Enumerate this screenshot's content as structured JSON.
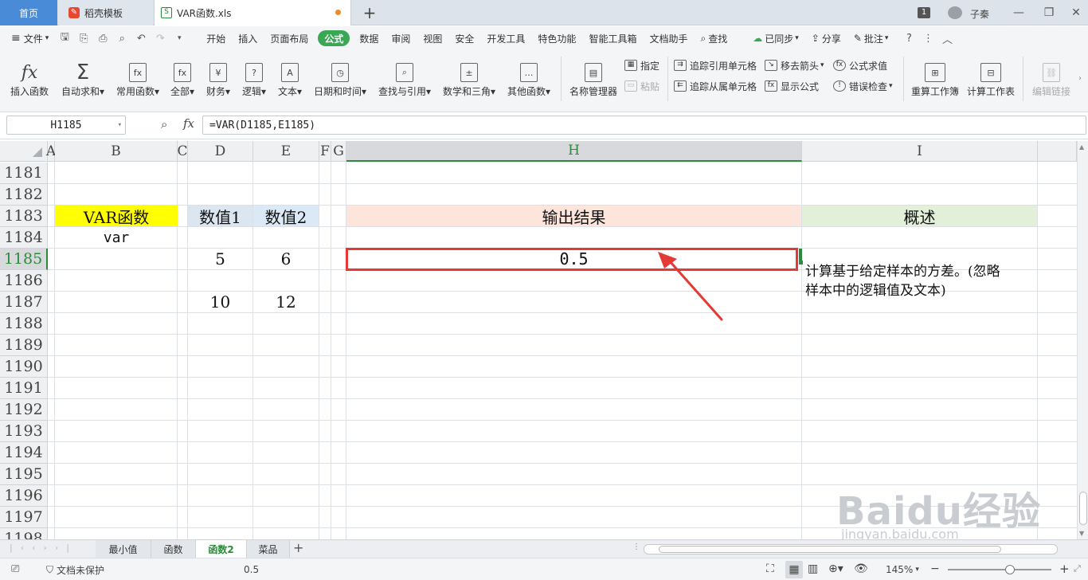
{
  "window": {
    "tabs": [
      {
        "label": "首页"
      },
      {
        "label": "稻壳模板"
      },
      {
        "label": "VAR函数.xls"
      }
    ],
    "page_badge": "1",
    "user_name": "子秦"
  },
  "menubar": {
    "file_label": "文件",
    "items": [
      "开始",
      "插入",
      "页面布局",
      "公式",
      "数据",
      "审阅",
      "视图",
      "安全",
      "开发工具",
      "特色功能",
      "智能工具箱",
      "文档助手"
    ],
    "active_item": "公式",
    "search_label": "查找",
    "sync_label": "已同步",
    "share_label": "分享",
    "comment_label": "批注"
  },
  "ribbon": {
    "insert_fn": "插入函数",
    "autosum": "自动求和",
    "common_fn": "常用函数",
    "all": "全部",
    "finance": "财务",
    "logic": "逻辑",
    "text": "文本",
    "datetime": "日期和时间",
    "lookup": "查找与引用",
    "math": "数学和三角",
    "other_fn": "其他函数",
    "name_mgr": "名称管理器",
    "specify": "指定",
    "paste": "粘贴",
    "trace_prec": "追踪引用单元格",
    "trace_dep": "追踪从属单元格",
    "remove_arrows": "移去箭头",
    "show_formula": "显示公式",
    "eval_formula": "公式求值",
    "error_check": "错误检查",
    "recalc_book": "重算工作簿",
    "calc_sheet": "计算工作表",
    "edit_links": "编辑链接"
  },
  "formula_bar": {
    "name_box": "H1185",
    "formula": "=VAR(D1185,E1185)"
  },
  "grid": {
    "columns": [
      "A",
      "B",
      "C",
      "D",
      "E",
      "F",
      "G",
      "H",
      "I"
    ],
    "selected_column": "H",
    "rows": [
      "1181",
      "1182",
      "1183",
      "1184",
      "1185",
      "1186",
      "1187",
      "1188",
      "1189",
      "1190",
      "1191",
      "1192",
      "1193",
      "1194",
      "1195",
      "1196",
      "1197",
      "1198"
    ],
    "selected_row": "1185",
    "cells": {
      "B1183": "VAR函数",
      "D1183": "数值1",
      "E1183": "数值2",
      "H1183": "输出结果",
      "I1183": "概述",
      "B1184": "var",
      "D1185": "5",
      "E1185": "6",
      "H1185": "0.5",
      "D1187": "10",
      "E1187": "12"
    },
    "description_lines": [
      "计算基于给定样本的方差。(忽略",
      "样本中的逻辑值及文本)"
    ],
    "colors": {
      "b_header": "#ffff00",
      "d_header": "#dce6f1",
      "e_header": "#dbe8f5",
      "h_header": "#fde5dc",
      "i_header": "#e2efd9",
      "selection": "#e53935",
      "arrow": "#e53935"
    }
  },
  "sheets": {
    "tabs": [
      "最小值",
      "函数",
      "函数2",
      "菜品"
    ],
    "active": "函数2"
  },
  "status": {
    "protection": "文档未保护",
    "value": "0.5",
    "zoom": "145%"
  },
  "watermark": {
    "brand": "Baidu经验",
    "url": "jingyan.baidu.com"
  }
}
